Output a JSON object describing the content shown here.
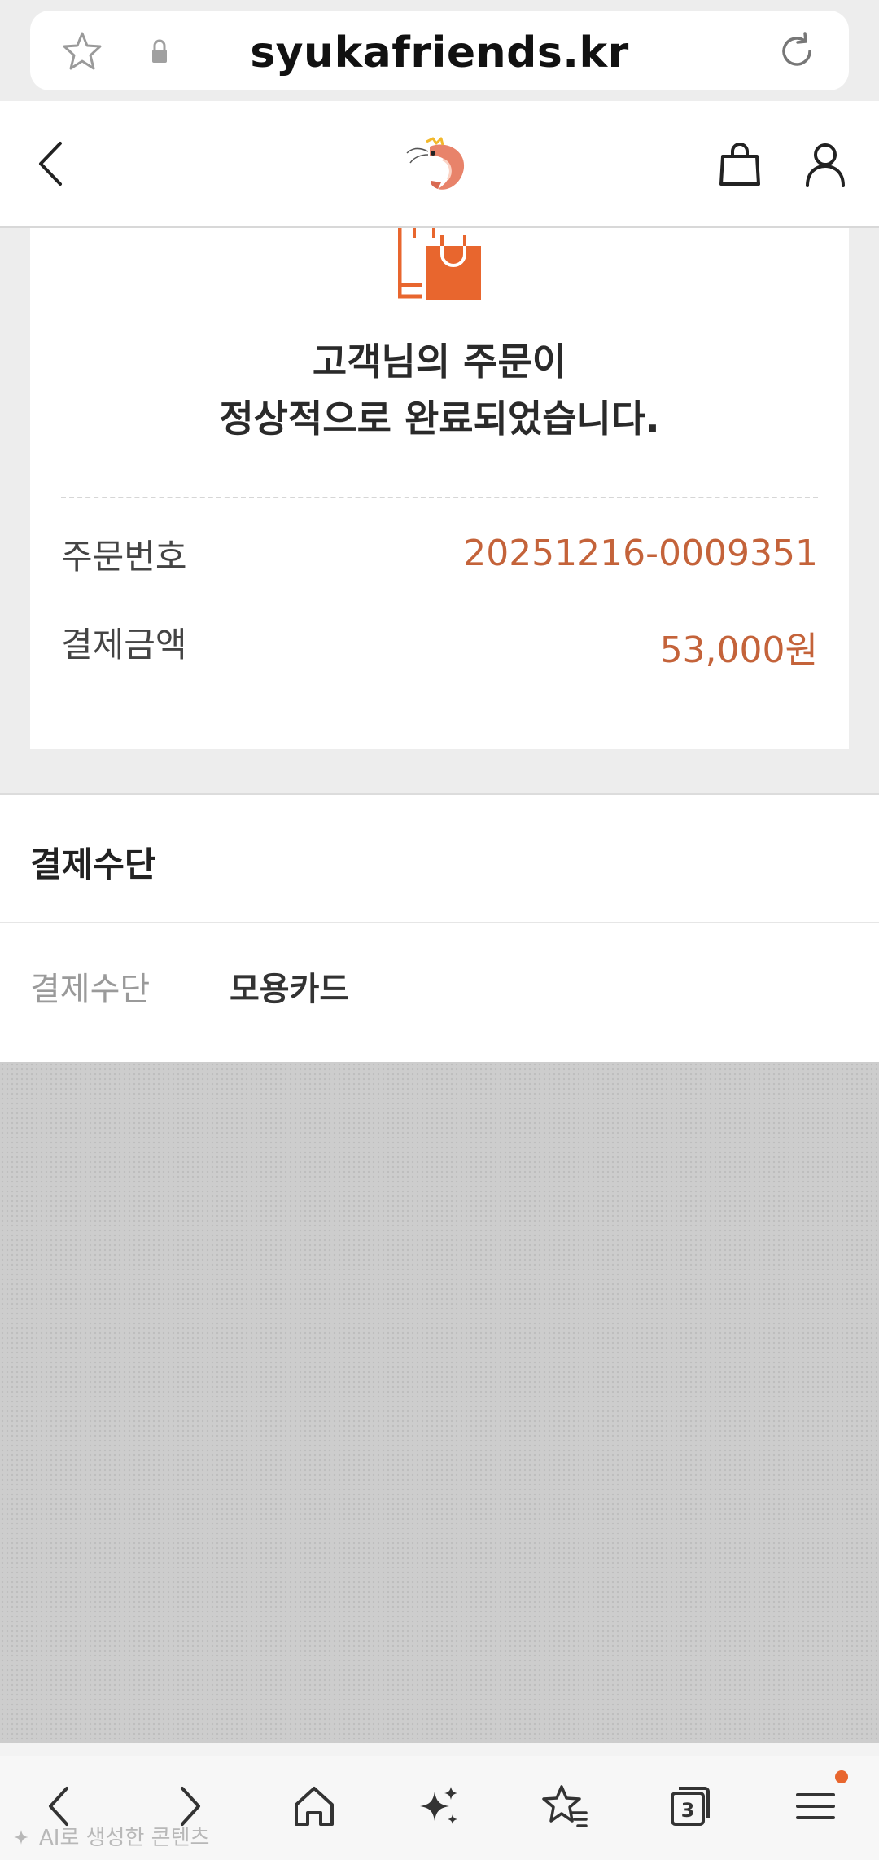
{
  "browser": {
    "url": "syukafriends.kr",
    "tab_count": "3"
  },
  "order": {
    "title_line1": "고객님의 주문이",
    "title_line2": "정상적으로 완료되었습니다.",
    "order_number_label": "주문번호",
    "order_number_value": "20251216-0009351",
    "amount_label": "결제금액",
    "amount_value": "53,000원"
  },
  "payment": {
    "section_title": "결제수단",
    "method_label": "결제수단",
    "method_value": "모용카드"
  },
  "watermark": "AI로 생성한 콘텐츠",
  "colors": {
    "accent": "#c4633a",
    "icon_orange": "#e8662e",
    "background": "#ededed"
  },
  "icons": [
    "star-icon",
    "lock-icon",
    "reload-icon",
    "back-icon",
    "shrimp-logo",
    "shopping-bag-icon",
    "user-icon",
    "order-complete-bag-icon",
    "nav-back-icon",
    "nav-forward-icon",
    "home-icon",
    "sparkle-icon",
    "bookmarks-icon",
    "tabs-icon",
    "menu-icon"
  ]
}
